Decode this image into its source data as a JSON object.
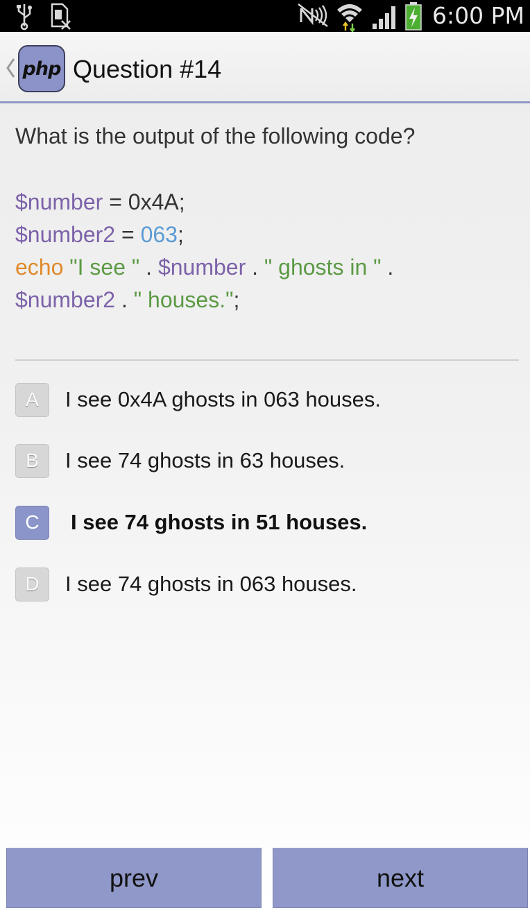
{
  "status_bar": {
    "time": "6:00 PM",
    "icons": [
      "usb-icon",
      "no-sim-icon",
      "nfc-muted-icon",
      "wifi-icon",
      "signal-icon",
      "battery-charging-icon"
    ]
  },
  "header": {
    "logo_text": "php",
    "title": "Question #14"
  },
  "question": {
    "prompt": "What is the output of the following code?",
    "code": {
      "line1": {
        "var": "$number",
        "op": " = 0x4A;"
      },
      "line2": {
        "var": "$number2",
        "op": " = ",
        "num": "063",
        "end": ";"
      },
      "line3": {
        "kw": "echo",
        "str1": " \"I see \"",
        "dot1": " . ",
        "var": "$number",
        "dot2": " . ",
        "str2": "\" ghosts in \"",
        "dot3": " ."
      },
      "line4": {
        "var": "$number2",
        "dot": " . ",
        "str": "\" houses.\"",
        "end": ";"
      }
    }
  },
  "answers": [
    {
      "letter": "A",
      "text": "I see 0x4A ghosts in 063 houses.",
      "selected": false
    },
    {
      "letter": "B",
      "text": "I see 74 ghosts in 63 houses.",
      "selected": false
    },
    {
      "letter": "C",
      "text": "I see 74 ghosts in 51 houses.",
      "selected": true
    },
    {
      "letter": "D",
      "text": "I see 74 ghosts in 063 houses.",
      "selected": false
    }
  ],
  "nav": {
    "prev_label": "prev",
    "next_label": "next"
  },
  "colors": {
    "accent": "#8f98c8",
    "divider": "#8f95c6",
    "code_variable": "#7c62a9",
    "code_number": "#5b9bd5",
    "code_keyword": "#e08a2c",
    "code_string": "#5c9a45"
  }
}
